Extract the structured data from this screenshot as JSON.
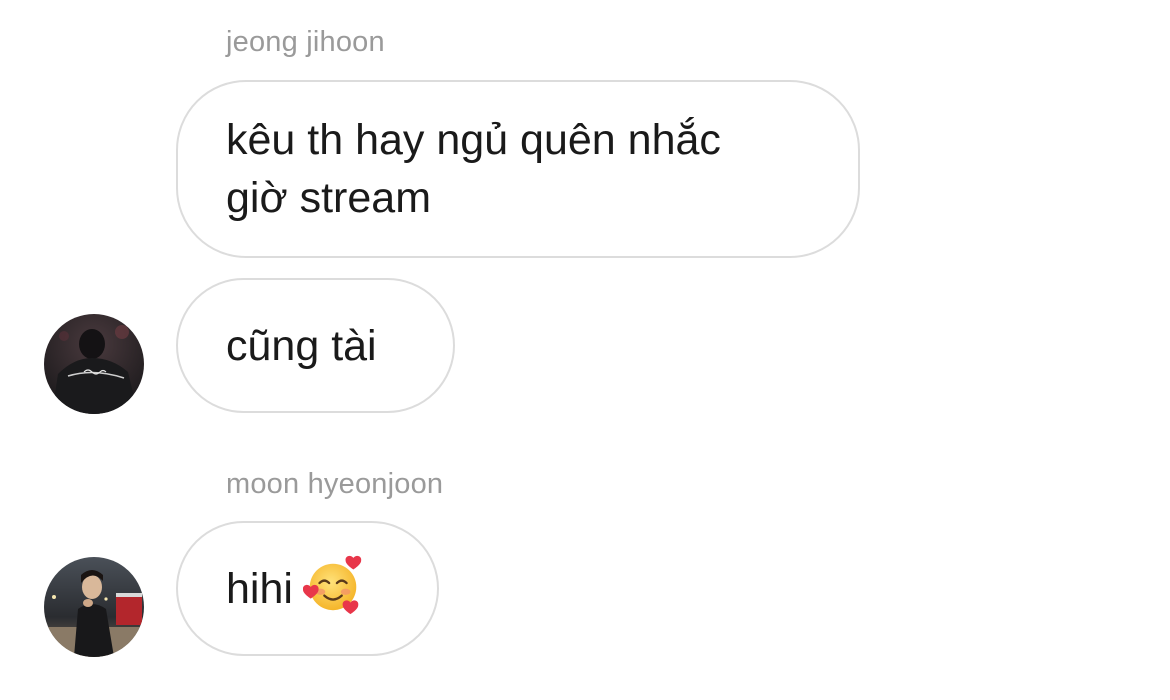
{
  "messages": [
    {
      "sender": "jeong jihoon",
      "text": "kêu th hay ngủ quên nhắc\ngiờ stream"
    },
    {
      "sender": "jeong jihoon",
      "text": "cũng tài"
    },
    {
      "sender": "moon hyeonjoon",
      "text": "hihi",
      "emoji": "smiling-face-with-hearts-icon"
    }
  ],
  "colors": {
    "name_text": "#9a9a9a",
    "bubble_border": "#dcdcdc",
    "message_text": "#1a1a1a",
    "background": "#ffffff"
  }
}
